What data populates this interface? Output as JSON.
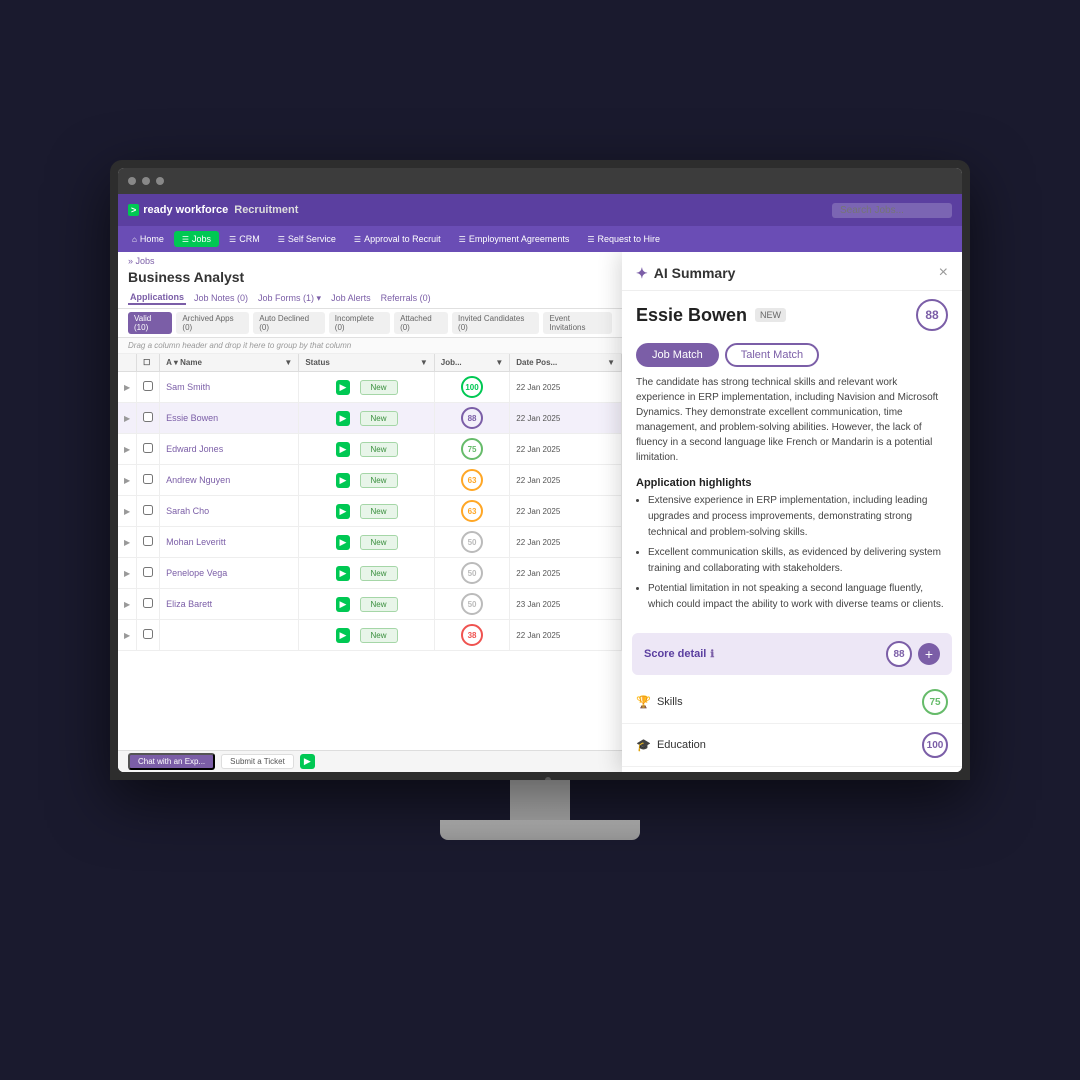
{
  "brand": {
    "icon": ">",
    "name": "ready workforce",
    "sub": "Recruitment",
    "search_placeholder": "Search Jobs..."
  },
  "nav": {
    "tabs": [
      {
        "label": "Home",
        "icon": "⌂",
        "active": false
      },
      {
        "label": "Jobs",
        "icon": "☰",
        "active": true
      },
      {
        "label": "CRM",
        "icon": "☰",
        "active": false
      },
      {
        "label": "Self Service",
        "icon": "☰",
        "active": false
      },
      {
        "label": "Approval to Recruit",
        "icon": "☰",
        "active": false
      },
      {
        "label": "Employment Agreements",
        "icon": "☰",
        "active": false
      },
      {
        "label": "Request to Hire",
        "icon": "☰",
        "active": false
      }
    ]
  },
  "breadcrumb": "» Jobs",
  "page_title": "Business Analyst",
  "sub_tabs": [
    {
      "label": "Applications",
      "active": true
    },
    {
      "label": "Job Notes (0)",
      "active": false
    },
    {
      "label": "Job Forms (1)",
      "active": false
    },
    {
      "label": "Job Alerts",
      "active": false
    },
    {
      "label": "Referrals (0)",
      "active": false
    }
  ],
  "filters": [
    {
      "label": "Valid (10)",
      "active": true
    },
    {
      "label": "Archived Apps (0)",
      "active": false
    },
    {
      "label": "Auto Declined (0)",
      "active": false
    },
    {
      "label": "Incomplete (0)",
      "active": false
    },
    {
      "label": "Attached (0)",
      "active": false
    },
    {
      "label": "Invited Candidates (0)",
      "active": false
    },
    {
      "label": "Event Invitations",
      "active": false
    }
  ],
  "drag_hint": "Drag a column header and drop it here to group by that column",
  "table": {
    "columns": [
      "",
      "",
      "Name",
      "Status",
      "Job...",
      "Date Pos..."
    ],
    "rows": [
      {
        "name": "Sam Smith",
        "status": "New",
        "score": 100,
        "score_class": "score-100",
        "date": "22 Jan 2025"
      },
      {
        "name": "Essie Bowen",
        "status": "New",
        "score": 88,
        "score_class": "score-88",
        "date": "22 Jan 2025"
      },
      {
        "name": "Edward Jones",
        "status": "New",
        "score": 75,
        "score_class": "score-75",
        "date": "22 Jan 2025"
      },
      {
        "name": "Andrew Nguyen",
        "status": "New",
        "score": 63,
        "score_class": "score-63",
        "date": "22 Jan 2025"
      },
      {
        "name": "Sarah Cho",
        "status": "New",
        "score": 63,
        "score_class": "score-63",
        "date": "22 Jan 2025"
      },
      {
        "name": "Mohan Leveritt",
        "status": "New",
        "score": 50,
        "score_class": "score-50",
        "date": "22 Jan 2025"
      },
      {
        "name": "Penelope Vega",
        "status": "New",
        "score": 50,
        "score_class": "score-50",
        "date": "22 Jan 2025"
      },
      {
        "name": "Eliza Barett",
        "status": "New",
        "score": 50,
        "score_class": "score-50",
        "date": "23 Jan 2025"
      },
      {
        "name": "",
        "status": "New",
        "score": 38,
        "score_class": "score-38",
        "date": "22 Jan 2025"
      }
    ]
  },
  "bottom_bar": {
    "chat_btn": "Chat with an Exp...",
    "ticket_btn": "Submit a Ticket"
  },
  "ai_panel": {
    "title": "AI Summary",
    "close": "×",
    "candidate_name": "Essie Bowen",
    "badge": "NEW",
    "score": "88",
    "match_tabs": [
      {
        "label": "Job Match",
        "active": true
      },
      {
        "label": "Talent Match",
        "active": false
      }
    ],
    "description": "The candidate has strong technical skills and relevant work experience in ERP implementation, including Navision and Microsoft Dynamics. They demonstrate excellent communication, time management, and problem-solving abilities. However, the lack of fluency in a second language like French or Mandarin is a potential limitation.",
    "highlights_title": "Application highlights",
    "highlights": [
      "Extensive experience in ERP implementation, including leading upgrades and process improvements, demonstrating strong technical and problem-solving skills.",
      "Excellent communication skills, as evidenced by delivering system training and collaborating with stakeholders.",
      "Potential limitation in not speaking a second language fluently, which could impact the ability to work with diverse teams or clients."
    ],
    "score_detail": {
      "label": "Score detail",
      "score": "88",
      "sub_scores": [
        {
          "icon": "🏆",
          "label": "Skills",
          "score": "75",
          "score_class": "score-green"
        },
        {
          "icon": "🎓",
          "label": "Education",
          "score": "100",
          "score_class": "score-purple-sm"
        }
      ]
    }
  }
}
